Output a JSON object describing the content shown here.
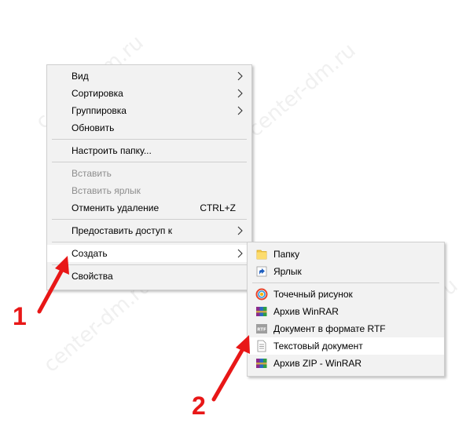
{
  "watermark_text": "center-dm.ru",
  "context_menu": {
    "items": [
      {
        "label": "Вид"
      },
      {
        "label": "Сортировка"
      },
      {
        "label": "Группировка"
      },
      {
        "label": "Обновить"
      },
      {
        "label": "Настроить папку..."
      },
      {
        "label": "Вставить"
      },
      {
        "label": "Вставить ярлык"
      },
      {
        "label": "Отменить удаление",
        "shortcut": "CTRL+Z"
      },
      {
        "label": "Предоставить доступ к"
      },
      {
        "label": "Создать"
      },
      {
        "label": "Свойства"
      }
    ]
  },
  "create_submenu": {
    "items": [
      {
        "label": "Папку",
        "icon": "folder-icon"
      },
      {
        "label": "Ярлык",
        "icon": "shortcut-icon"
      },
      {
        "label": "Точечный рисунок",
        "icon": "bitmap-icon"
      },
      {
        "label": "Архив WinRAR",
        "icon": "winrar-icon"
      },
      {
        "label": "Документ в формате RTF",
        "icon": "rtf-icon"
      },
      {
        "label": "Текстовый документ",
        "icon": "text-document-icon"
      },
      {
        "label": "Архив ZIP - WinRAR",
        "icon": "winrar-zip-icon"
      }
    ]
  },
  "annotations": {
    "step1": "1",
    "step2": "2",
    "color": "#e81717"
  },
  "rtf_badge": "RTF"
}
